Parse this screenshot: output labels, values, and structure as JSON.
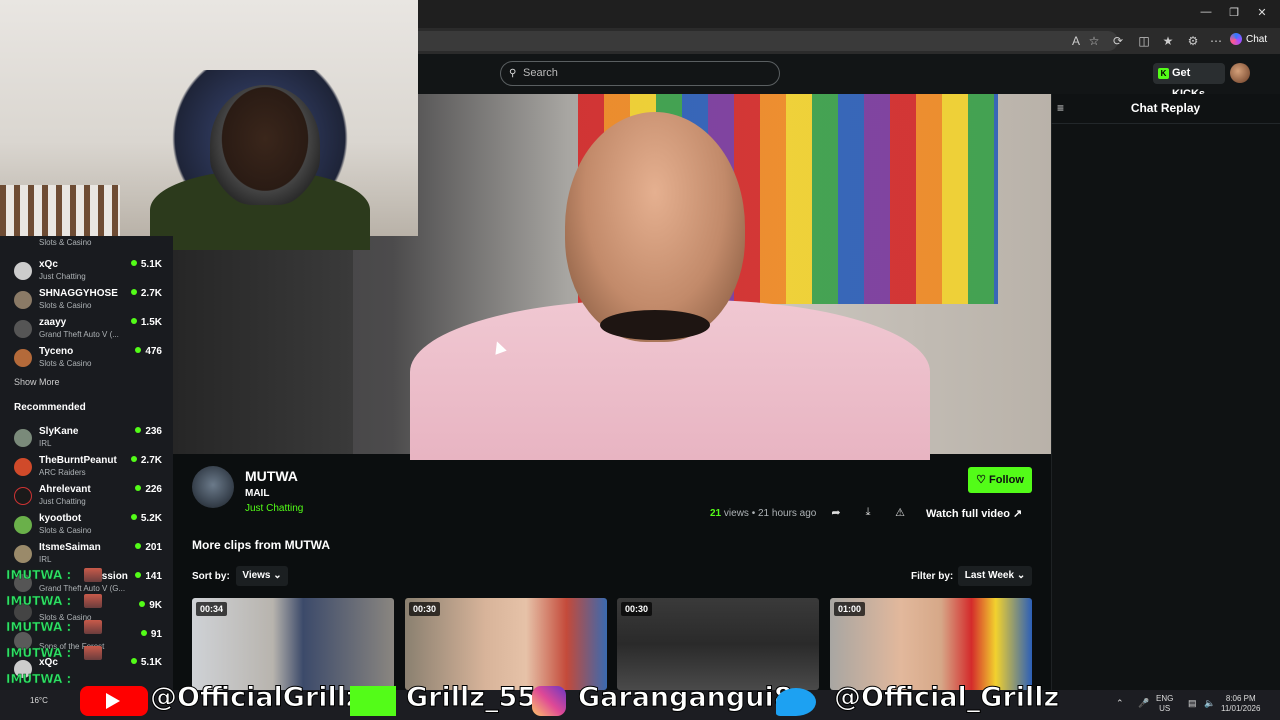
{
  "browser": {
    "chat_label": "Chat",
    "toolbar_icons": [
      "read-aloud-icon",
      "favorite-icon",
      "refresh-icon",
      "favorites-icon",
      "extension-icon",
      "more-icon"
    ]
  },
  "header": {
    "search_placeholder": "Search",
    "get_kicks_label": "Get KICKs"
  },
  "chat": {
    "title": "Chat Replay"
  },
  "sidebar": {
    "following": [
      {
        "name": "",
        "category": "Slots & Casino",
        "viewers": ""
      },
      {
        "name": "xQc",
        "category": "Just Chatting",
        "viewers": "5.1K"
      },
      {
        "name": "SHNAGGYHOSE",
        "category": "Slots & Casino",
        "viewers": "2.7K"
      },
      {
        "name": "zaayy",
        "category": "Grand Theft Auto V (...",
        "viewers": "1.5K"
      },
      {
        "name": "Tyceno",
        "category": "Slots & Casino",
        "viewers": "476"
      }
    ],
    "show_more": "Show More",
    "recommended_title": "Recommended",
    "recommended": [
      {
        "name": "SlyKane",
        "category": "IRL",
        "viewers": "236"
      },
      {
        "name": "TheBurntPeanut",
        "category": "ARC Raiders",
        "viewers": "2.7K"
      },
      {
        "name": "Ahrelevant",
        "category": "Just Chatting",
        "viewers": "226"
      },
      {
        "name": "kyootbot",
        "category": "Slots & Casino",
        "viewers": "5.2K"
      },
      {
        "name": "ItsmeSaiman",
        "category": "IRL",
        "viewers": "201"
      },
      {
        "name": "Psession",
        "category": "Grand Theft Auto V (G...",
        "viewers": "141"
      },
      {
        "name": "",
        "category": "Slots & Casino",
        "viewers": "9K"
      },
      {
        "name": "",
        "category": "Sons of the Forest",
        "viewers": "91"
      },
      {
        "name": "xQc",
        "category": "Just Chatting",
        "viewers": "5.1K"
      }
    ]
  },
  "channel": {
    "name": "MUTWA",
    "title": "MAIL",
    "category": "Just Chatting",
    "follow_label": "Follow",
    "views_count": "21",
    "views_label": "views",
    "time_ago": "• 21 hours ago",
    "watch_full_label": "Watch full video"
  },
  "clips": {
    "heading": "More clips from MUTWA",
    "sort_label": "Sort by:",
    "sort_value": "Views",
    "filter_label": "Filter by:",
    "filter_value": "Last Week",
    "items": [
      {
        "duration": "00:34"
      },
      {
        "duration": "00:30"
      },
      {
        "duration": "00:30"
      },
      {
        "duration": "01:00"
      }
    ]
  },
  "overlay": {
    "chat_lines": [
      "IMUTWA :",
      "IMUTWA :",
      "IMUTWA :",
      "IMUTWA :",
      "IMUTWA :"
    ],
    "socials": {
      "youtube": "@OfficialGrillz",
      "kick": "Grillz_55",
      "instagram": "Garanganguі8",
      "twitter": "@Official_Grillz"
    }
  },
  "taskbar": {
    "weather": "16°C",
    "lang_line1": "ENG",
    "lang_line2": "US",
    "time": "8:06 PM",
    "date": "11/01/2026"
  }
}
